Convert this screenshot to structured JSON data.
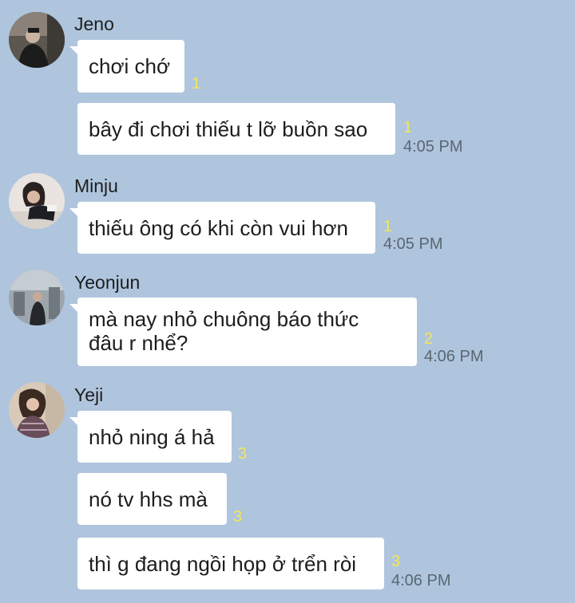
{
  "chat": {
    "groups": [
      {
        "sender": "Jeno",
        "messages": [
          {
            "text": "chơi chớ",
            "unread": "1",
            "time": ""
          },
          {
            "text": "bây đi chơi thiếu t lỡ buồn sao",
            "unread": "1",
            "time": "4:05 PM"
          }
        ]
      },
      {
        "sender": "Minju",
        "messages": [
          {
            "text": "thiếu ông có khi còn vui hơn",
            "unread": "1",
            "time": "4:05 PM"
          }
        ]
      },
      {
        "sender": "Yeonjun",
        "messages": [
          {
            "text_line1": "mà nay nhỏ chuông báo thức",
            "text_line2": "đâu r nhể?",
            "unread": "2",
            "time": "4:06 PM"
          }
        ]
      },
      {
        "sender": "Yeji",
        "messages": [
          {
            "text": "nhỏ ning á hả",
            "unread": "3",
            "time": ""
          },
          {
            "text": "nó tv hhs mà",
            "unread": "3",
            "time": ""
          },
          {
            "text": "thì g đang ngồi họp ở trển ròi",
            "unread": "3",
            "time": "4:06 PM"
          }
        ]
      }
    ]
  },
  "colors": {
    "background": "#afc5dd",
    "bubble": "#ffffff",
    "unread": "#f4e55a",
    "time": "#5a6672"
  },
  "icons": {
    "avatar_jeno": "avatar-photo",
    "avatar_minju": "avatar-photo",
    "avatar_yeonjun": "avatar-photo",
    "avatar_yeji": "avatar-photo"
  }
}
